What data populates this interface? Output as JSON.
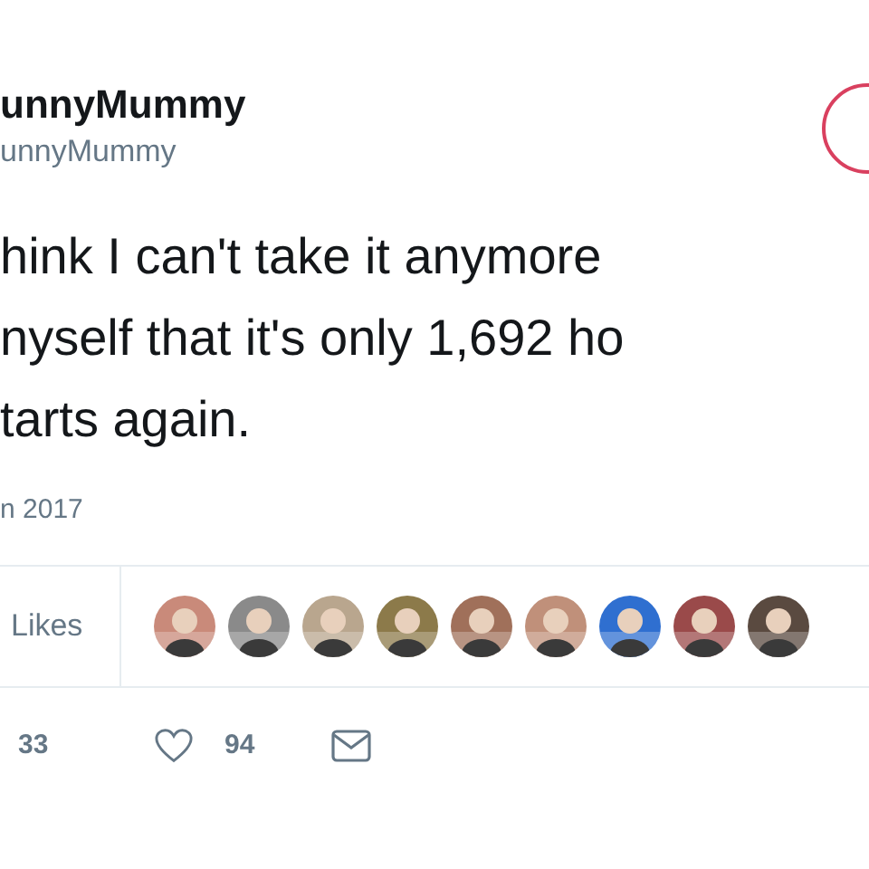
{
  "author": {
    "name": "unnyMummy",
    "handle": "unnyMummy"
  },
  "tweet_lines": [
    "hink I can't take it anymore",
    "nyself that it's only 1,692 ho",
    "tarts again."
  ],
  "date": "n 2017",
  "likes": {
    "label": "Likes"
  },
  "actions": {
    "retweets": "33",
    "likes": "94",
    "liked": false
  }
}
